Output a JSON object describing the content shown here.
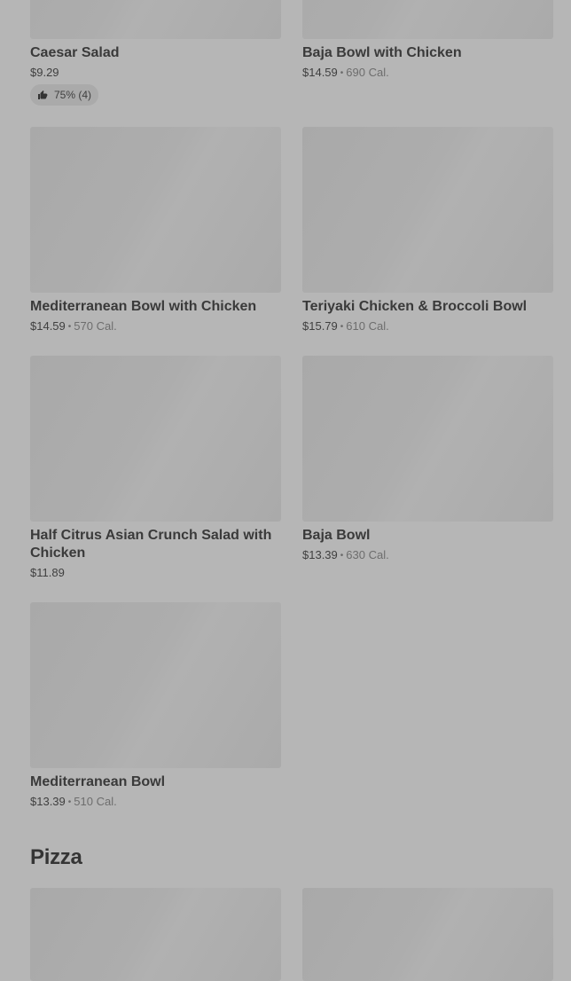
{
  "items": [
    {
      "name": "Caesar Salad",
      "price": "$9.29",
      "cal": "",
      "rating": "75% (4)"
    },
    {
      "name": "Baja Bowl with Chicken",
      "price": "$14.59",
      "cal": "690 Cal."
    },
    {
      "name": "Mediterranean Bowl with Chicken",
      "price": "$14.59",
      "cal": "570 Cal."
    },
    {
      "name": "Teriyaki Chicken & Broccoli Bowl",
      "price": "$15.79",
      "cal": "610 Cal."
    },
    {
      "name": "Half Citrus Asian Crunch Salad with Chicken",
      "price": "$11.89",
      "cal": ""
    },
    {
      "name": "Baja Bowl",
      "price": "$13.39",
      "cal": "630 Cal."
    },
    {
      "name": "Mediterranean Bowl",
      "price": "$13.39",
      "cal": "510 Cal."
    }
  ],
  "sections": {
    "pizza_title": "Pizza"
  },
  "separator": "•",
  "icons": {
    "rating": "thumbs-up-icon"
  }
}
